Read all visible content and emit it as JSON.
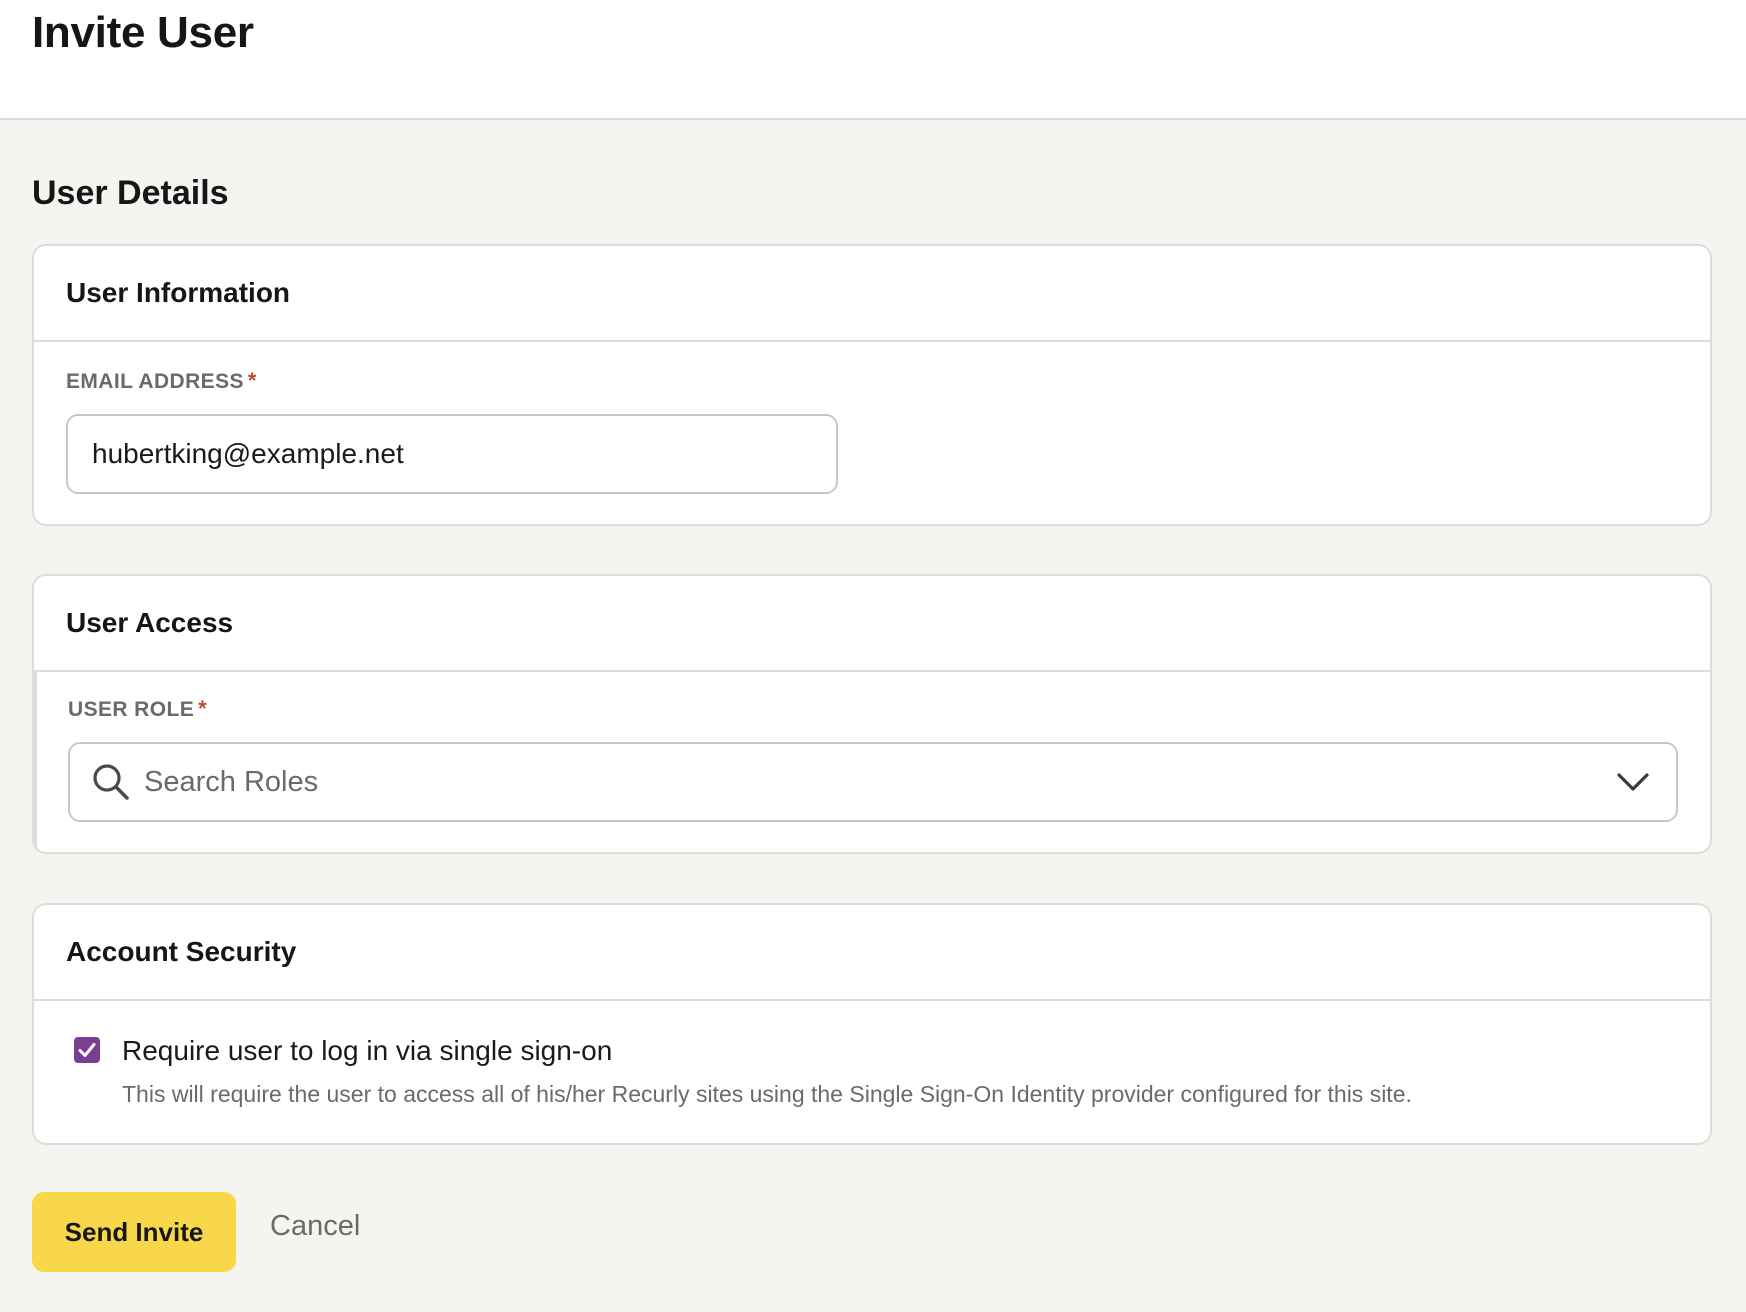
{
  "page": {
    "title": "Invite User",
    "section_title": "User Details"
  },
  "user_information": {
    "title": "User Information",
    "email_label": "EMAIL ADDRESS",
    "required_marker": "*",
    "email_value": "hubertking@example.net"
  },
  "user_access": {
    "title": "User Access",
    "role_label": "USER ROLE",
    "required_marker": "*",
    "role_placeholder": "Search Roles",
    "search_icon": "search-icon",
    "dropdown_icon": "chevron-down-icon"
  },
  "account_security": {
    "title": "Account Security",
    "sso_checked": true,
    "sso_label": "Require user to log in via single sign-on",
    "sso_help": "This will require the user to access all of his/her Recurly sites using the Single Sign-On Identity provider configured for this site."
  },
  "actions": {
    "send_label": "Send Invite",
    "cancel_label": "Cancel"
  },
  "colors": {
    "accent_button": "#f8d84a",
    "checkbox": "#7b3f91",
    "required": "#c24a2c",
    "page_background": "#f4f4f1"
  }
}
